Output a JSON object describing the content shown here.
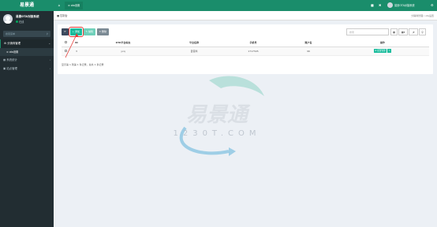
{
  "sidebar": {
    "logo": "易景通",
    "user_name": "易景OTA对接系统",
    "user_status": "在线",
    "search_placeholder": "搜索菜单",
    "menu": [
      {
        "label": "分销商管理",
        "open": true
      },
      {
        "label": "ota设置",
        "sub": true
      },
      {
        "label": "系统统计"
      },
      {
        "label": "站点管理"
      }
    ]
  },
  "topbar": {
    "tab_label": "ota设置",
    "user_label": "易景OTA对接系统"
  },
  "breadcrumb": {
    "left": "控制台",
    "right_1": "分销商管理",
    "right_sep": "/",
    "right_2": "ota设置"
  },
  "toolbar": {
    "add_label": "添加",
    "edit_label": "编辑",
    "delete_label": "删除",
    "search_placeholder": "搜索"
  },
  "table": {
    "headers": [
      "ID",
      "OTA平台标志",
      "平台名称",
      "手机号",
      "账户名",
      "操作"
    ],
    "rows": [
      {
        "id": "3",
        "flag": "yxq",
        "platform": "自营商",
        "phone": "1717505",
        "account": "96",
        "op_config": "配置管理"
      }
    ]
  },
  "pager": "显示第 1 到第 1 条记录，总共 1 条记录",
  "watermark": {
    "brand": "易景通",
    "domain": "1230T.COM"
  },
  "colors": {
    "brand": "#1a8d6b",
    "sidebar": "#222d32",
    "accent_button": "#18bc9c",
    "highlight": "#e53935"
  }
}
